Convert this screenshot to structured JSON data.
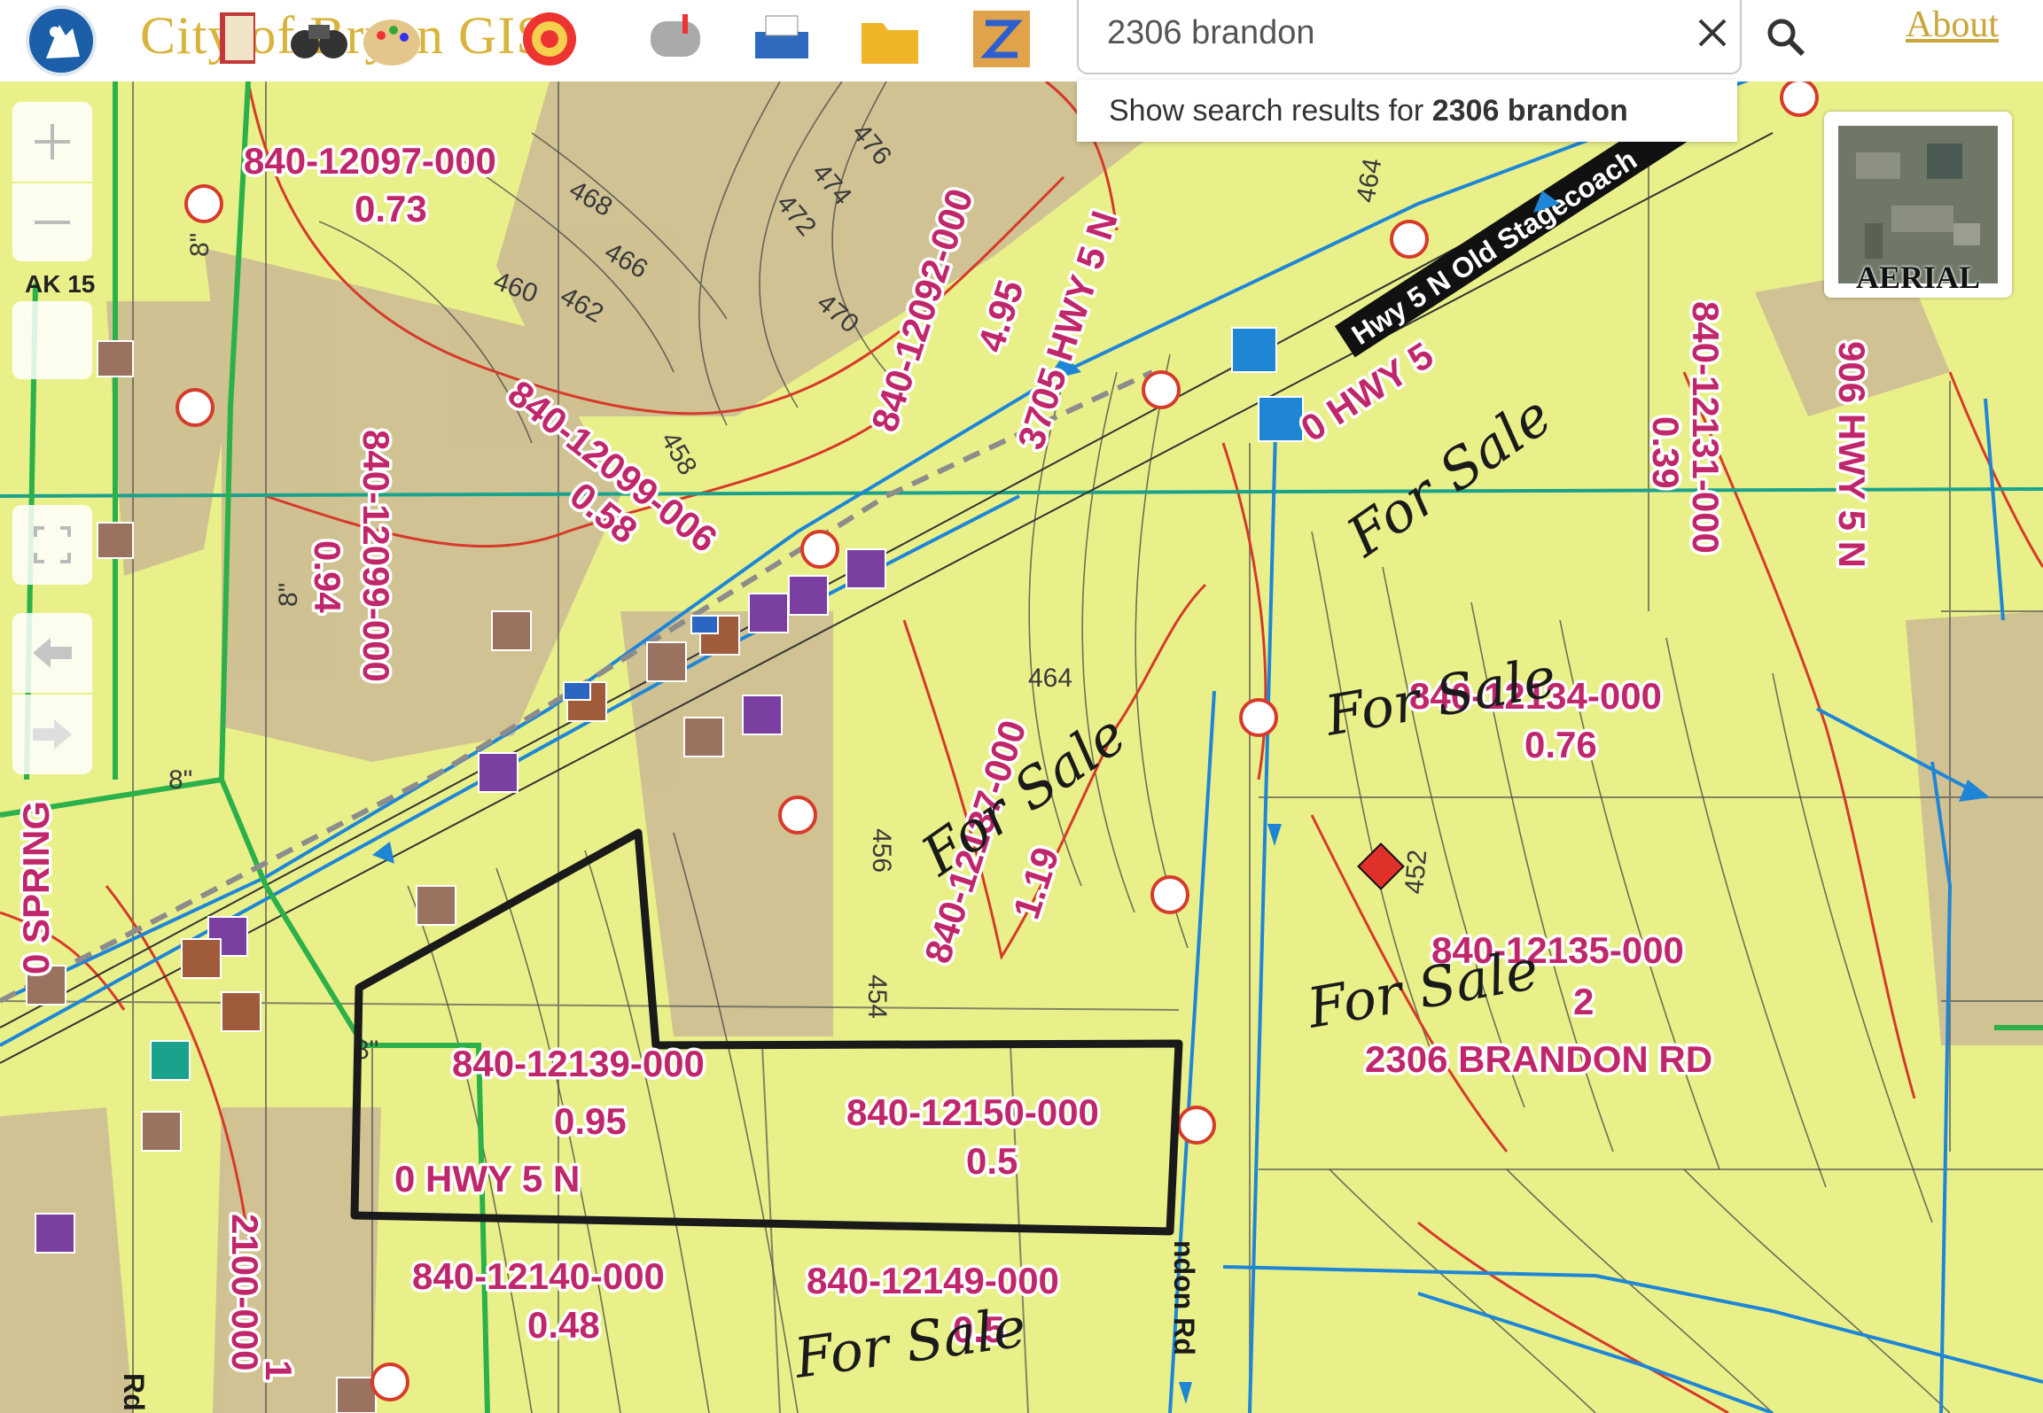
{
  "header": {
    "app_title": "City of Bryan GIS",
    "about_label": "About",
    "tools": [
      {
        "name": "bookmarks-tool",
        "icon": "book-icon"
      },
      {
        "name": "find-tool",
        "icon": "binoculars-icon"
      },
      {
        "name": "legend-tool",
        "icon": "palette-icon"
      },
      {
        "name": "basemap-tool",
        "icon": "globe-icon"
      },
      {
        "name": "mail-tool",
        "icon": "mailbox-icon"
      },
      {
        "name": "print-tool",
        "icon": "printer-icon"
      },
      {
        "name": "folder-tool",
        "icon": "folder-icon"
      },
      {
        "name": "zoning-tool",
        "icon": "zoning-map-icon"
      }
    ]
  },
  "search": {
    "value": "2306 brandon",
    "placeholder": "Search",
    "suggestion_prefix": "Show search results for ",
    "suggestion_term": "2306 brandon"
  },
  "controls": {
    "scale_tag": "AK 15",
    "aerial_label": "AERIAL"
  },
  "map": {
    "parcels": [
      {
        "id": "840-12097-000",
        "acres": "0.73"
      },
      {
        "id": "840-12092-000",
        "acres": "4.95",
        "address": "3705 HWY 5 N"
      },
      {
        "id": "840-12099-006",
        "acres": "0.58"
      },
      {
        "id": "840-12099-000",
        "acres": "0.94"
      },
      {
        "id": "840-12137-000",
        "acres": "1.19"
      },
      {
        "id": "840-12131-000",
        "acres": "0.39",
        "address": "906 HWY 5 N"
      },
      {
        "id": "840-12134-000",
        "acres": "0.76"
      },
      {
        "id": "840-12135-000",
        "acres": "2",
        "address": "2306 BRANDON RD"
      },
      {
        "id": "840-12139-000",
        "acres": "0.95",
        "address": "0 HWY 5 N"
      },
      {
        "id": "840-12150-000",
        "acres": "0.5"
      },
      {
        "id": "840-12140-000",
        "acres": "0.48"
      },
      {
        "id": "840-12149-000",
        "acres": "0.5"
      },
      {
        "id": "2100-000",
        "acres": "1"
      }
    ],
    "road_label": "Hwy 5 N Old Stagecoach",
    "hwy_label": "0 HWY 5",
    "street_labels": {
      "left": "0 SPRING",
      "brandon": "ndon Rd",
      "left_bottom": "Rd"
    },
    "contours": [
      "476",
      "474",
      "472",
      "470",
      "468",
      "466",
      "464",
      "462",
      "460",
      "458",
      "456",
      "454",
      "452",
      "464"
    ],
    "pipe_size": "8\"",
    "annotations": {
      "for_sale": "For Sale"
    },
    "colors": {
      "base": "#e9f08a",
      "tan_area": "#c9b98d",
      "parcel_label": "#c0276b",
      "contour_red": "#d63a2a",
      "water_blue": "#1f86d6",
      "sewer_green": "#2bb04a",
      "teal_line": "#1aa28c",
      "outline": "#1a1a1a"
    }
  }
}
